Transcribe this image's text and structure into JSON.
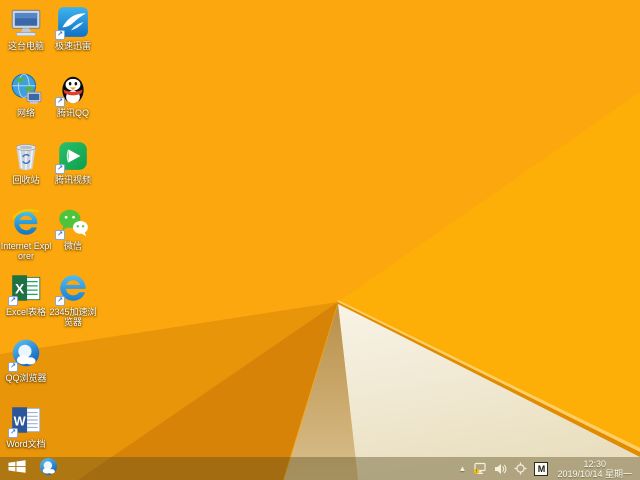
{
  "desktop": {
    "icons": [
      {
        "label": "这台电脑",
        "name": "this-pc"
      },
      {
        "label": "极速迅雷",
        "name": "xunlei"
      },
      {
        "label": "网络",
        "name": "network"
      },
      {
        "label": "腾讯QQ",
        "name": "tencent-qq"
      },
      {
        "label": "回收站",
        "name": "recycle-bin"
      },
      {
        "label": "腾讯视频",
        "name": "tencent-video"
      },
      {
        "label": "Internet Explorer",
        "name": "internet-explorer"
      },
      {
        "label": "微信",
        "name": "wechat"
      },
      {
        "label": "Excel表格",
        "name": "excel"
      },
      {
        "label": "2345加速浏览器",
        "name": "2345-browser"
      },
      {
        "label": "QQ浏览器",
        "name": "qq-browser"
      },
      {
        "label": "Word文档",
        "name": "word"
      }
    ],
    "wallpaper_colors": {
      "base": "#FBA70D",
      "bright_facet": "#FFB106",
      "ridge_dark": "#E18C00",
      "ridge_light": "#FFCе66",
      "cream_facet": "#F2ECD8",
      "tan_facet": "#CBA45E",
      "shadow_facet": "rgba(170,85,0,0.22)",
      "deep_shadow_facet": "rgba(150,70,0,0.22)"
    }
  },
  "taskbar": {
    "tray": {
      "time": "12:30",
      "date": "2019/10/14 星期一",
      "ime": "M"
    }
  }
}
